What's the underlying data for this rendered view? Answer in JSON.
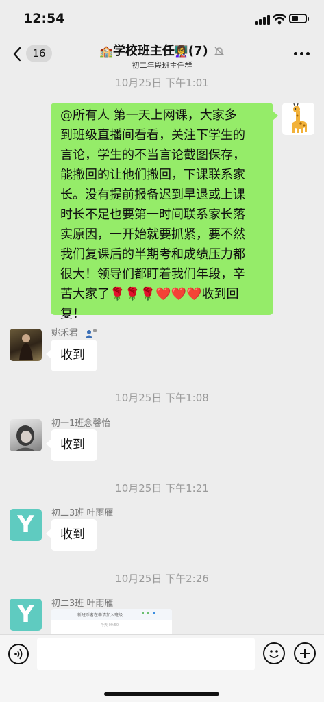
{
  "status_bar": {
    "time": "12:54"
  },
  "header": {
    "back_badge": "16",
    "title_prefix_emoji": "🏫",
    "title": "学校班主任",
    "title_suffix_emoji": "👩‍🏫",
    "member_count": "(7)",
    "subtitle": "初二年段班主任群"
  },
  "messages": [
    {
      "type": "time",
      "text": "10月25日 下午1:01"
    },
    {
      "type": "text",
      "from": "me",
      "avatar_icon": "giraffe-icon",
      "lines": [
        "@所有人 第一天上网课，大家多",
        "到班级直播间看看，关注下学生的",
        "言论，学生的不当言论截图保存，",
        "能撤回的让他们撤回，下课联系家",
        "长。没有提前报备迟到早退或上课",
        "时长不足也要第一时间联系家长落",
        "实原因，一开始就要抓紧，要不然",
        "我们复课后的半期考和成绩压力都",
        "很大！领导们都盯着我们年段，辛",
        "苦大家了🌹🌹🌹❤️❤️❤️收到回",
        "复！"
      ]
    },
    {
      "type": "text",
      "from": "other",
      "sender": "姚禾君",
      "sender_badge_icon": "device-badge-icon",
      "text": "收到"
    },
    {
      "type": "time",
      "text": "10月25日 下午1:08"
    },
    {
      "type": "text",
      "from": "other",
      "sender": "初一1班念馨怡",
      "text": "收到"
    },
    {
      "type": "time",
      "text": "10月25日 下午1:21"
    },
    {
      "type": "text",
      "from": "other",
      "sender": "初二3班 叶雨雁",
      "avatar_letter": "Y",
      "text": "收到"
    },
    {
      "type": "time",
      "text": "10月25日 下午2:26"
    },
    {
      "type": "image",
      "from": "other",
      "sender": "初二3班 叶雨雁",
      "avatar_letter": "Y",
      "preview_text": "新班币者在申请加入班级…",
      "preview_subtext": "今天 09:50"
    }
  ],
  "input_bar": {
    "placeholder": ""
  },
  "colors": {
    "bubble_me": "#95ec69",
    "bubble_other": "#ffffff",
    "background": "#ededed",
    "y_avatar": "#5fcbc0"
  }
}
